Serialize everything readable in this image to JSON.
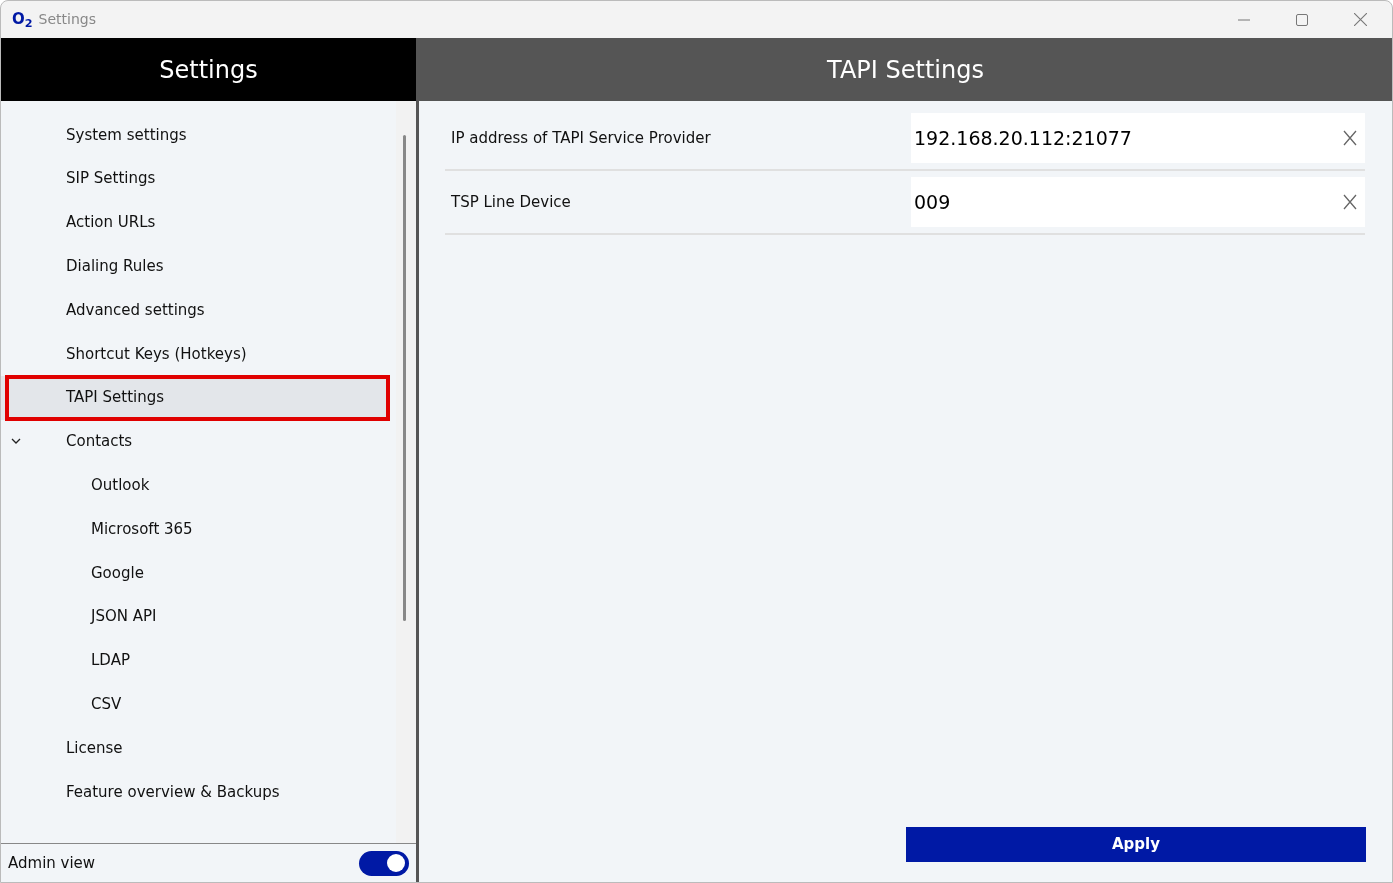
{
  "window": {
    "logo": "O$_{2}$",
    "title": "Settings"
  },
  "sidebar": {
    "title": "Settings",
    "items": [
      {
        "label": "System settings",
        "selected": false
      },
      {
        "label": "SIP Settings",
        "selected": false
      },
      {
        "label": "Action URLs",
        "selected": false
      },
      {
        "label": "Dialing Rules",
        "selected": false
      },
      {
        "label": "Advanced settings",
        "selected": false
      },
      {
        "label": "Shortcut Keys (Hotkeys)",
        "selected": false
      },
      {
        "label": "TAPI Settings",
        "selected": true,
        "highlighted": true
      },
      {
        "label": "Contacts",
        "selected": false,
        "expanded": true,
        "children": [
          {
            "label": "Outlook",
            "selected": false
          },
          {
            "label": "Microsoft 365",
            "selected": false
          },
          {
            "label": "Google",
            "selected": false
          },
          {
            "label": "JSON API",
            "selected": false
          },
          {
            "label": "LDAP",
            "selected": false
          },
          {
            "label": "CSV",
            "selected": false
          }
        ]
      },
      {
        "label": "License",
        "selected": false
      },
      {
        "label": "Feature overview & Backups",
        "selected": false
      }
    ],
    "admin_view": {
      "label": "Admin view",
      "on": true
    }
  },
  "content": {
    "title": "TAPI Settings",
    "fields": [
      {
        "label": "IP address of TAPI Service Provider",
        "value": "192.168.20.112:21077"
      },
      {
        "label": "TSP Line Device",
        "value": "009"
      }
    ],
    "apply_button": "Apply"
  }
}
